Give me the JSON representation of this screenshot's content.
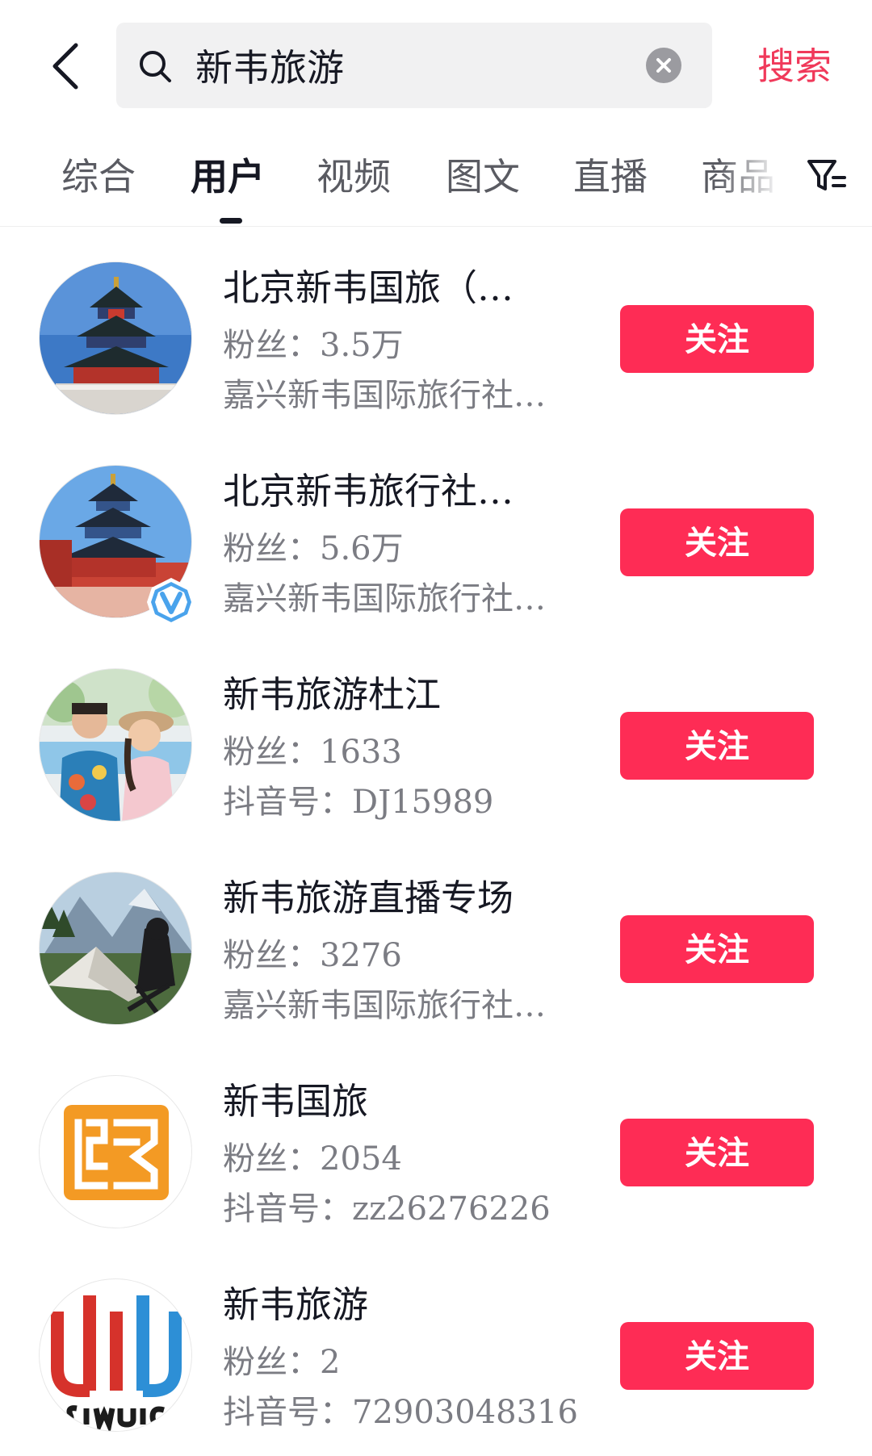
{
  "search": {
    "query": "新韦旅游",
    "submit_label": "搜索",
    "icons": {
      "back": "chevron-left-icon",
      "search": "search-icon",
      "clear": "clear-icon"
    }
  },
  "tabs": {
    "items": [
      {
        "label": "综合",
        "active": false
      },
      {
        "label": "用户",
        "active": true
      },
      {
        "label": "视频",
        "active": false
      },
      {
        "label": "图文",
        "active": false
      },
      {
        "label": "直播",
        "active": false
      },
      {
        "label": "商品",
        "active": false
      }
    ],
    "filter_icon": "filter-icon"
  },
  "users": [
    {
      "name": "北京新韦国旅（…",
      "fans": "粉丝：3.5万",
      "sub": "嘉兴新韦国际旅行社…",
      "follow_label": "关注",
      "avatar": "temple-of-heaven-avatar",
      "verified": false
    },
    {
      "name": "北京新韦旅行社…",
      "fans": "粉丝：5.6万",
      "sub": "嘉兴新韦国际旅行社…",
      "follow_label": "关注",
      "avatar": "temple-of-heaven-avatar",
      "verified": true
    },
    {
      "name": "新韦旅游杜江",
      "fans": "粉丝：1633",
      "sub": "抖音号：DJ15989",
      "follow_label": "关注",
      "avatar": "couple-photo-avatar",
      "verified": false
    },
    {
      "name": "新韦旅游直播专场",
      "fans": "粉丝：3276",
      "sub": "嘉兴新韦国际旅行社…",
      "follow_label": "关注",
      "avatar": "mountain-camping-avatar",
      "verified": false
    },
    {
      "name": "新韦国旅",
      "fans": "粉丝：2054",
      "sub": "抖音号：zz26276226",
      "follow_label": "关注",
      "avatar": "orange-logo-avatar",
      "verified": false
    },
    {
      "name": "新韦旅游",
      "fans": "粉丝：2",
      "sub": "抖音号：72903048316",
      "follow_label": "关注",
      "avatar": "red-blue-logo-avatar",
      "verified": false
    }
  ],
  "colors": {
    "accent": "#fe2c55",
    "search_link": "#f0395a",
    "text_primary": "#161823",
    "text_secondary": "#7b7c83",
    "search_bg": "#f1f1f2"
  }
}
